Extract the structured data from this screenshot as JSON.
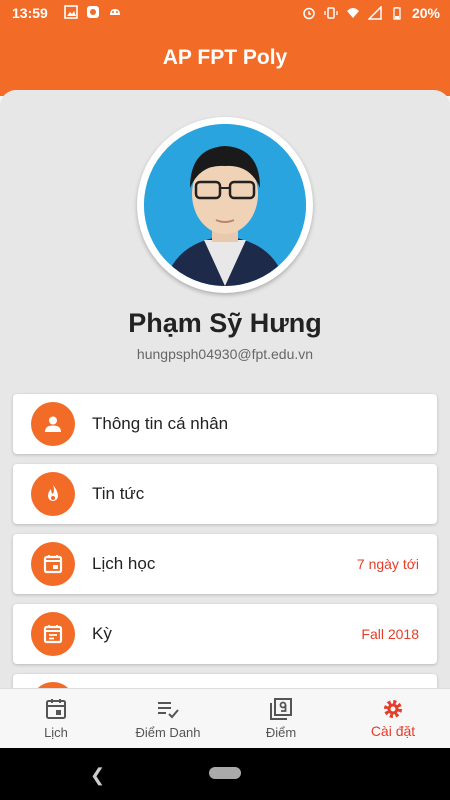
{
  "status_bar": {
    "time": "13:59",
    "battery": "20%"
  },
  "app_bar": {
    "title": "AP FPT Poly"
  },
  "profile": {
    "name": "Phạm Sỹ Hưng",
    "email": "hungpsph04930@fpt.edu.vn"
  },
  "menu": [
    {
      "label": "Thông tin cá nhân",
      "value": "",
      "icon": "person-icon"
    },
    {
      "label": "Tin tức",
      "value": "",
      "icon": "fire-icon"
    },
    {
      "label": "Lịch học",
      "value": "7 ngày tới",
      "icon": "calendar-icon"
    },
    {
      "label": "Kỳ",
      "value": "Fall 2018",
      "icon": "term-icon"
    }
  ],
  "bottom_nav": {
    "items": [
      {
        "label": "Lịch",
        "icon": "calendar-icon"
      },
      {
        "label": "Điểm Danh",
        "icon": "checklist-icon"
      },
      {
        "label": "Điểm",
        "icon": "grade-icon"
      },
      {
        "label": "Cài đặt",
        "icon": "gear-icon",
        "active": true
      }
    ]
  },
  "colors": {
    "accent": "#f26b27",
    "highlight": "#e53d2a"
  }
}
